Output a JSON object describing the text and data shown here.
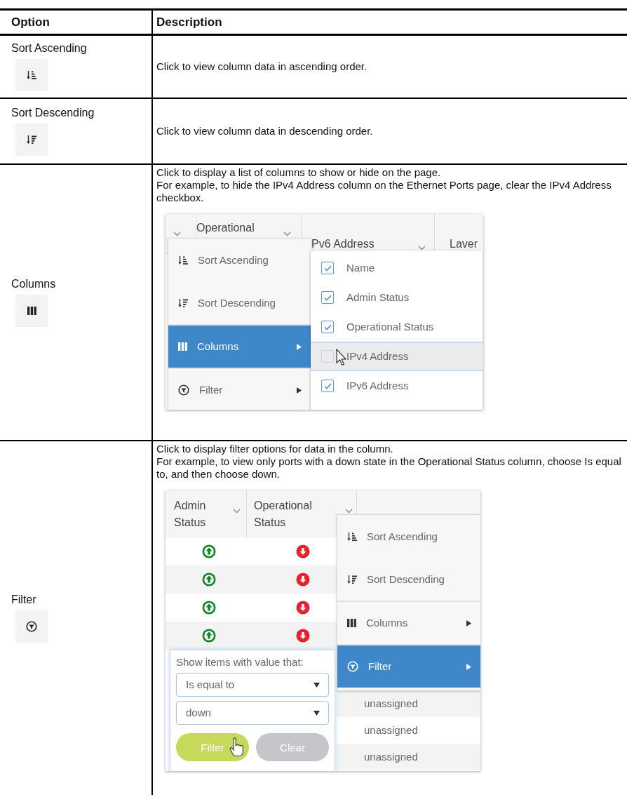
{
  "table": {
    "columns": [
      "Option",
      "Description"
    ],
    "rows": [
      {
        "option": "Sort Ascending",
        "kind": "sort_ascending",
        "description": [
          "Click to view column data in ascending order."
        ]
      },
      {
        "option": "Sort Descending",
        "kind": "sort_descending",
        "description": [
          "Click to view column data in descending order."
        ]
      },
      {
        "option": "Columns",
        "kind": "columns",
        "description": [
          "Click to display a list of columns to show or hide on the page.",
          "For example, to hide the IPv4 Address column on the Ethernet Ports page, clear the IPv4 Address checkbox."
        ],
        "screenshot": {
          "kind": "columns_menu",
          "header": [
            "Operational",
            "Pv6 Address",
            "Laver"
          ],
          "menu": [
            {
              "label": "Sort Ascending",
              "kind": "sort_ascending",
              "submenu": false,
              "selected": false
            },
            {
              "label": "Sort Descending",
              "kind": "sort_descending",
              "submenu": false,
              "selected": false
            },
            {
              "label": "Columns",
              "kind": "columns",
              "submenu": true,
              "selected": true
            },
            {
              "label": "Filter",
              "kind": "filter",
              "submenu": true,
              "selected": false
            }
          ],
          "columns": [
            {
              "label": "Name",
              "checked": true,
              "highlighted": false
            },
            {
              "label": "Admin Status",
              "checked": true,
              "highlighted": false
            },
            {
              "label": "Operational Status",
              "checked": true,
              "highlighted": false
            },
            {
              "label": "IPv4 Address",
              "checked": false,
              "highlighted": true
            },
            {
              "label": "IPv6 Address",
              "checked": true,
              "highlighted": false
            }
          ]
        }
      },
      {
        "option": "Filter",
        "kind": "filter",
        "description": [
          "Click to display filter options for data in the column.",
          "For example, to view only ports with a down state in the Operational Status column, choose Is equal to, and then choose down."
        ],
        "screenshot": {
          "kind": "filter_menu",
          "header": [
            "Admin Status",
            "Operational Status"
          ],
          "rows": [
            {
              "cells": [
                {
                  "kind": "up"
                },
                {
                  "kind": "down"
                }
              ]
            },
            {
              "cells": [
                {
                  "kind": "up"
                },
                {
                  "kind": "down"
                }
              ]
            },
            {
              "cells": [
                {
                  "kind": "up"
                },
                {
                  "kind": "down"
                }
              ]
            },
            {
              "cells": [
                {
                  "kind": "up"
                },
                {
                  "kind": "down"
                }
              ]
            }
          ],
          "menu": [
            {
              "label": "Sort Ascending",
              "kind": "sort_ascending",
              "submenu": false,
              "selected": false
            },
            {
              "label": "Sort Descending",
              "kind": "sort_descending",
              "submenu": false,
              "selected": false
            },
            {
              "label": "Columns",
              "kind": "columns",
              "submenu": true,
              "selected": false
            },
            {
              "label": "Filter",
              "kind": "filter",
              "submenu": true,
              "selected": true
            }
          ],
          "cells": [
            "unassigned",
            "unassigned",
            "unassigned"
          ],
          "popup": {
            "prompt": "Show items with value that:",
            "condition": "Is equal to",
            "value": "down",
            "buttons": [
              {
                "label": "Filter",
                "kind": "primary"
              },
              {
                "label": "Clear",
                "kind": "secondary"
              }
            ]
          }
        }
      }
    ]
  }
}
